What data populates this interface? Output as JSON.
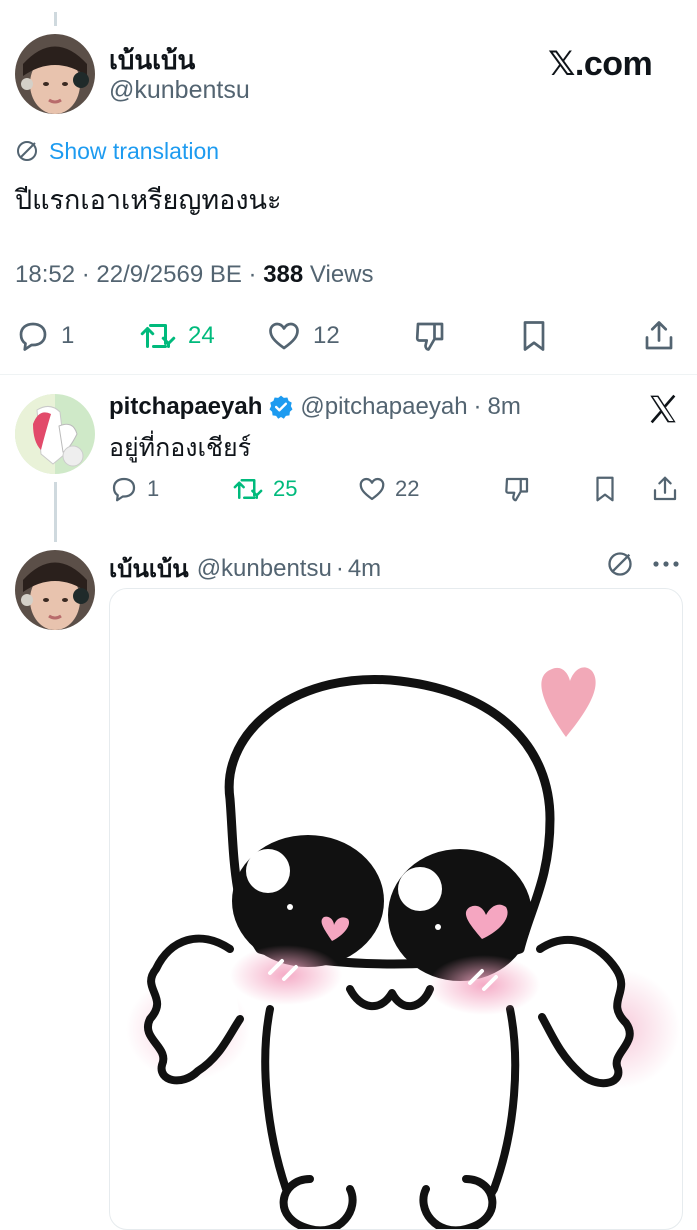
{
  "main_tweet": {
    "display_name": "เบ้นเบ้น",
    "handle": "@kunbentsu",
    "brand": "𝕏.com",
    "show_translation": "Show translation",
    "text": "ปีแรกเอาเหรียญทองนะ",
    "time": "18:52",
    "date": "22/9/2569 BE",
    "views_count": "388",
    "views_label": "Views",
    "actions": {
      "replies": "1",
      "retweets": "24",
      "likes": "12"
    }
  },
  "reply_tweet": {
    "display_name": "pitchapaeyah",
    "handle": "@pitchapaeyah",
    "time": "8m",
    "text": "อยู่ที่กองเชียร์",
    "actions": {
      "replies": "1",
      "retweets": "25",
      "likes": "22"
    }
  },
  "third_tweet": {
    "display_name": "เบ้นเบ้น",
    "handle": "@kunbentsu",
    "time": "4m"
  },
  "colors": {
    "accent": "#1d9bf0",
    "retweet": "#00ba7c",
    "muted": "#536471"
  },
  "icons": [
    "reply-icon",
    "retweet-icon",
    "like-icon",
    "dislike-icon",
    "bookmark-icon",
    "share-icon",
    "x-logo-icon",
    "verified-icon",
    "translate-icon",
    "more-icon"
  ]
}
